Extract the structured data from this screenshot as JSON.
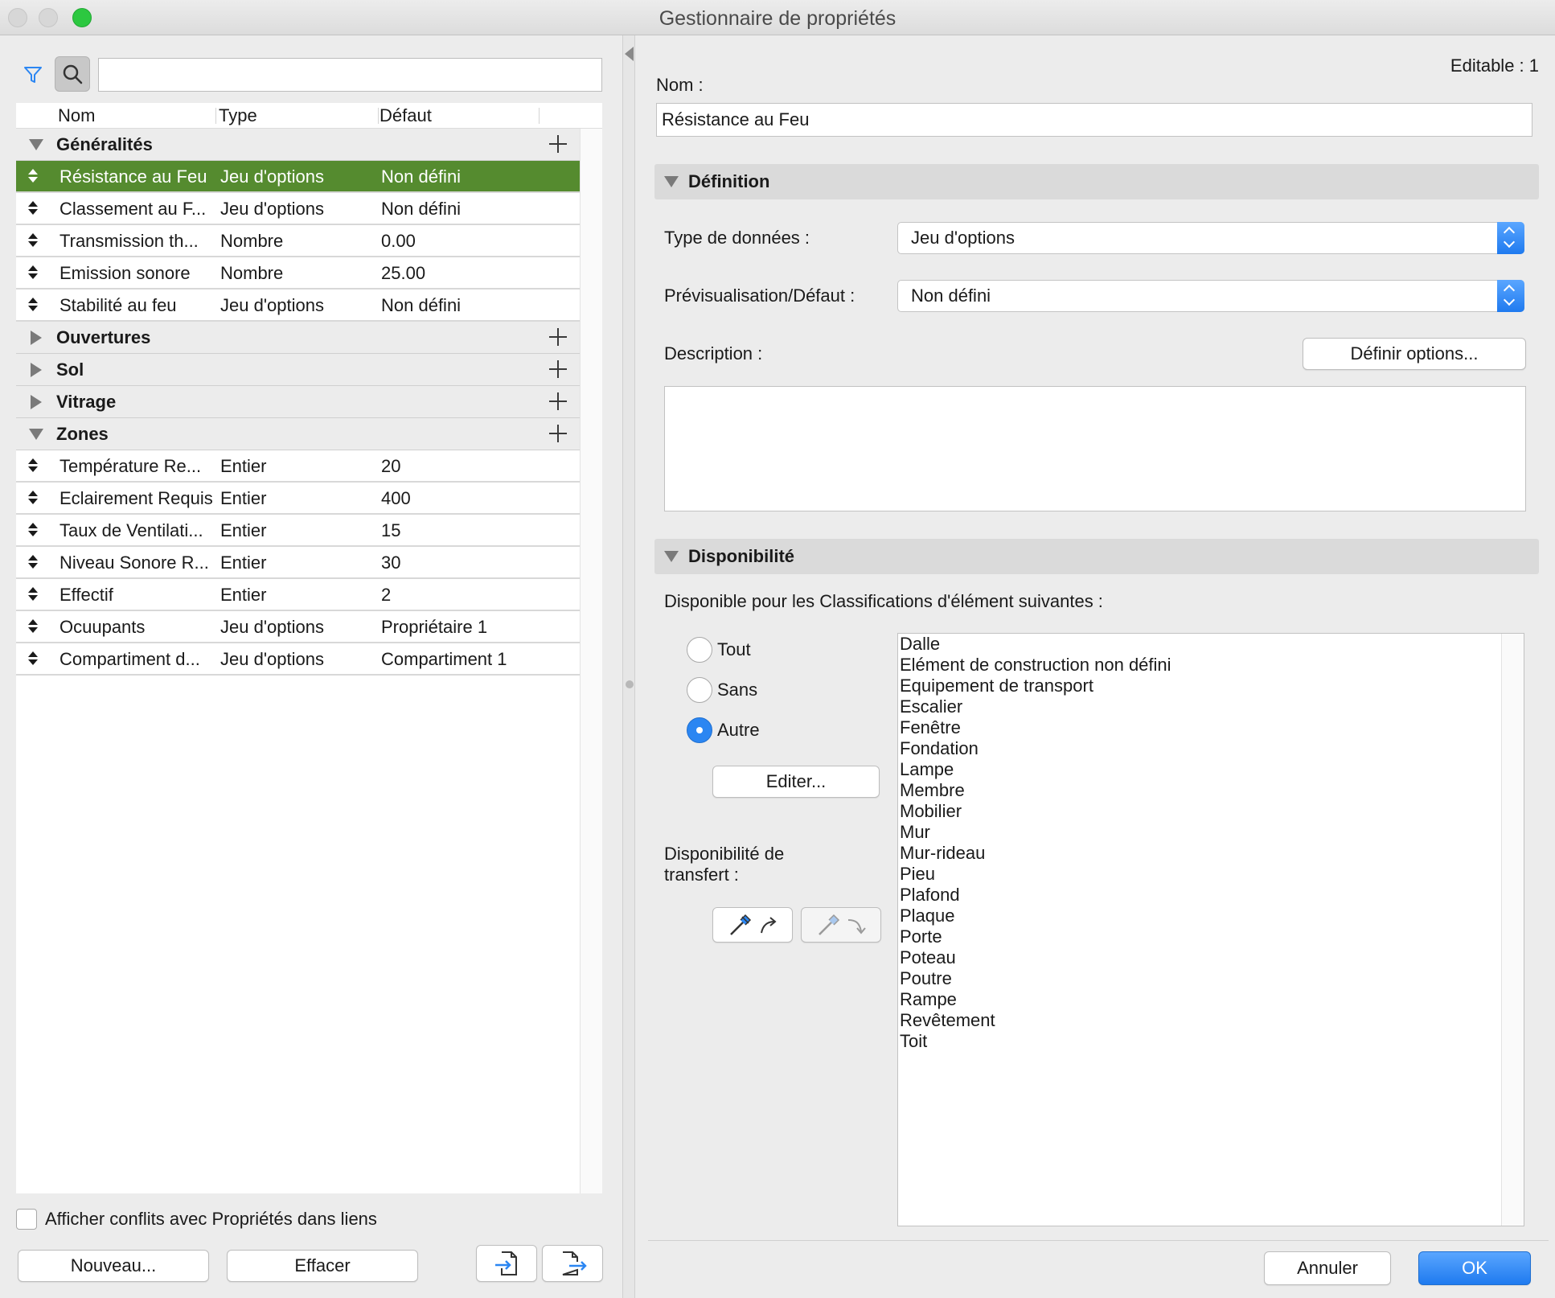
{
  "window": {
    "title": "Gestionnaire de propriétés"
  },
  "left": {
    "columns": [
      "Nom",
      "Type",
      "Défaut"
    ],
    "groups": [
      {
        "name": "Généralités",
        "expanded": true,
        "rows": [
          {
            "name": "Résistance au Feu",
            "type": "Jeu d'options",
            "default": "Non défini",
            "selected": true
          },
          {
            "name": "Classement au F...",
            "type": "Jeu d'options",
            "default": "Non défini"
          },
          {
            "name": "Transmission th...",
            "type": "Nombre",
            "default": "0.00"
          },
          {
            "name": "Emission sonore",
            "type": "Nombre",
            "default": "25.00"
          },
          {
            "name": "Stabilité au feu",
            "type": "Jeu d'options",
            "default": "Non défini"
          }
        ]
      },
      {
        "name": "Ouvertures",
        "expanded": false,
        "rows": []
      },
      {
        "name": "Sol",
        "expanded": false,
        "rows": []
      },
      {
        "name": "Vitrage",
        "expanded": false,
        "rows": []
      },
      {
        "name": "Zones",
        "expanded": true,
        "rows": [
          {
            "name": "Température Re...",
            "type": "Entier",
            "default": "20"
          },
          {
            "name": "Eclairement Requis",
            "type": "Entier",
            "default": "400"
          },
          {
            "name": "Taux de Ventilati...",
            "type": "Entier",
            "default": "15"
          },
          {
            "name": "Niveau Sonore R...",
            "type": "Entier",
            "default": "30"
          },
          {
            "name": "Effectif",
            "type": "Entier",
            "default": "2"
          },
          {
            "name": "Ocuupants",
            "type": "Jeu d'options",
            "default": "Propriétaire 1"
          },
          {
            "name": "Compartiment d...",
            "type": "Jeu d'options",
            "default": "Compartiment 1"
          }
        ]
      }
    ],
    "conflict_label": "Afficher conflits avec Propriétés dans liens",
    "new_button": "Nouveau...",
    "delete_button": "Effacer",
    "accent_color": "#558b2f"
  },
  "right": {
    "editable": "Editable : 1",
    "name_label": "Nom :",
    "name_value": "Résistance au Feu",
    "definition": {
      "title": "Définition",
      "datatype_label": "Type de données :",
      "datatype_value": "Jeu d'options",
      "preview_label": "Prévisualisation/Défaut :",
      "preview_value": "Non défini",
      "description_label": "Description :",
      "define_options_button": "Définir options..."
    },
    "availability": {
      "title": "Disponibilité",
      "intro": "Disponible pour les Classifications d'élément suivantes :",
      "radios": [
        {
          "label": "Tout",
          "checked": false
        },
        {
          "label": "Sans",
          "checked": false
        },
        {
          "label": "Autre",
          "checked": true
        }
      ],
      "edit_button": "Editer...",
      "transfer_label_line1": "Disponibilité de",
      "transfer_label_line2": "transfert :",
      "classifications": [
        "Dalle",
        "Elément de construction non défini",
        "Equipement de transport",
        "Escalier",
        "Fenêtre",
        "Fondation",
        "Lampe",
        "Membre",
        "Mobilier",
        "Mur",
        "Mur-rideau",
        "Pieu",
        "Plafond",
        "Plaque",
        "Porte",
        "Poteau",
        "Poutre",
        "Rampe",
        "Revêtement",
        "Toit"
      ]
    },
    "cancel_button": "Annuler",
    "ok_button": "OK",
    "primary_color": "#2b86f2"
  }
}
